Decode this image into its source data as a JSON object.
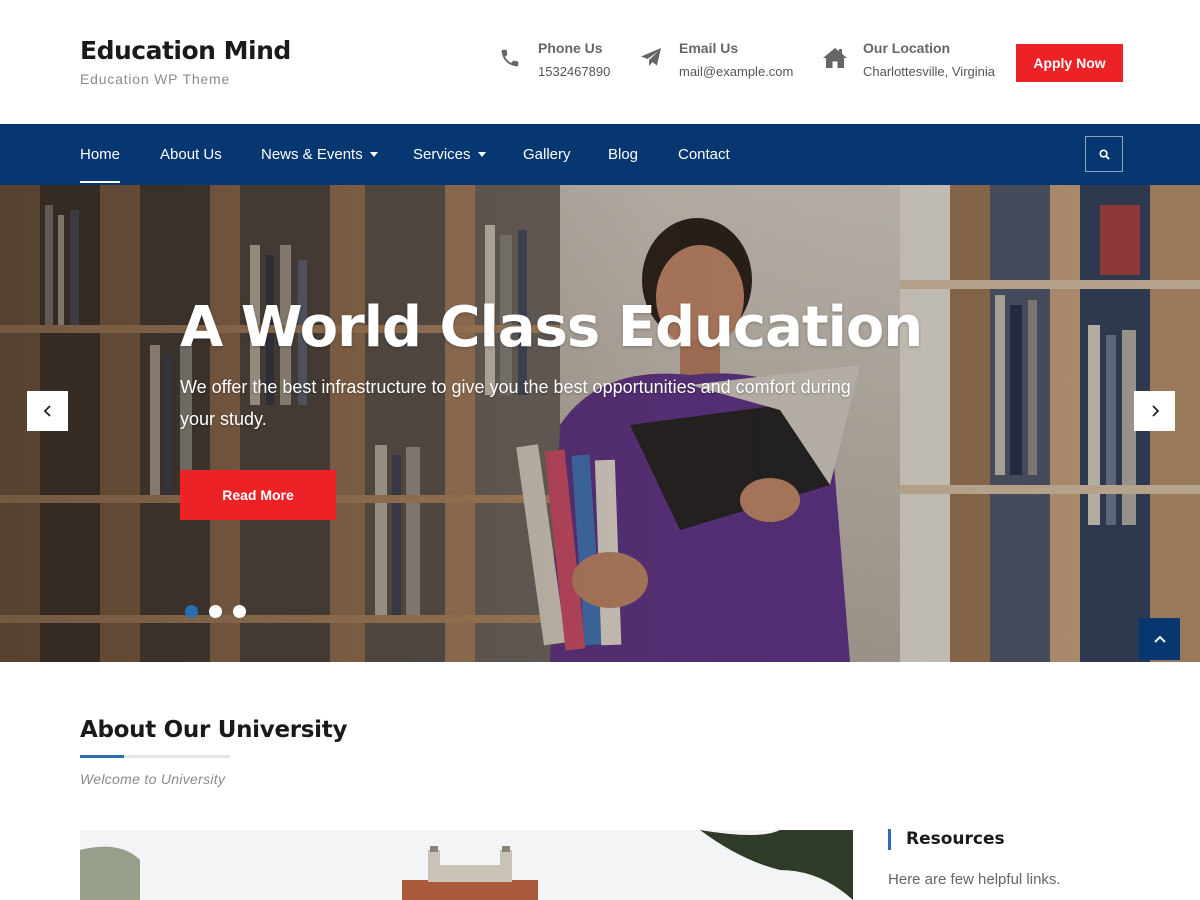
{
  "brand": {
    "title": "Education Mind",
    "tagline": "Education WP Theme"
  },
  "contacts": [
    {
      "icon": "phone-icon",
      "label": "Phone Us",
      "value": "1532467890"
    },
    {
      "icon": "paper-plane-icon",
      "label": "Email Us",
      "value": "mail@example.com"
    },
    {
      "icon": "home-icon",
      "label": "Our Location",
      "value": "Charlottesville, Virginia"
    }
  ],
  "apply_label": "Apply Now",
  "nav": {
    "items": [
      {
        "label": "Home",
        "active": true
      },
      {
        "label": "About Us"
      },
      {
        "label": "News & Events",
        "dropdown": true
      },
      {
        "label": "Services",
        "dropdown": true
      },
      {
        "label": "Gallery"
      },
      {
        "label": "Blog"
      },
      {
        "label": "Contact"
      }
    ]
  },
  "hero": {
    "title": "A World Class Education",
    "text": "We offer the best infrastructure to give you the best opportunities and comfort during your study.",
    "button": "Read More",
    "slides_total": 3,
    "active_slide": 1
  },
  "about": {
    "title": "About Our University",
    "subtitle": "Welcome to University"
  },
  "sidebar": {
    "title": "Resources",
    "text": "Here are few helpful links."
  },
  "colors": {
    "accent_red": "#ec2227",
    "nav_blue": "#063770",
    "highlight_blue": "#2c6cb0"
  }
}
